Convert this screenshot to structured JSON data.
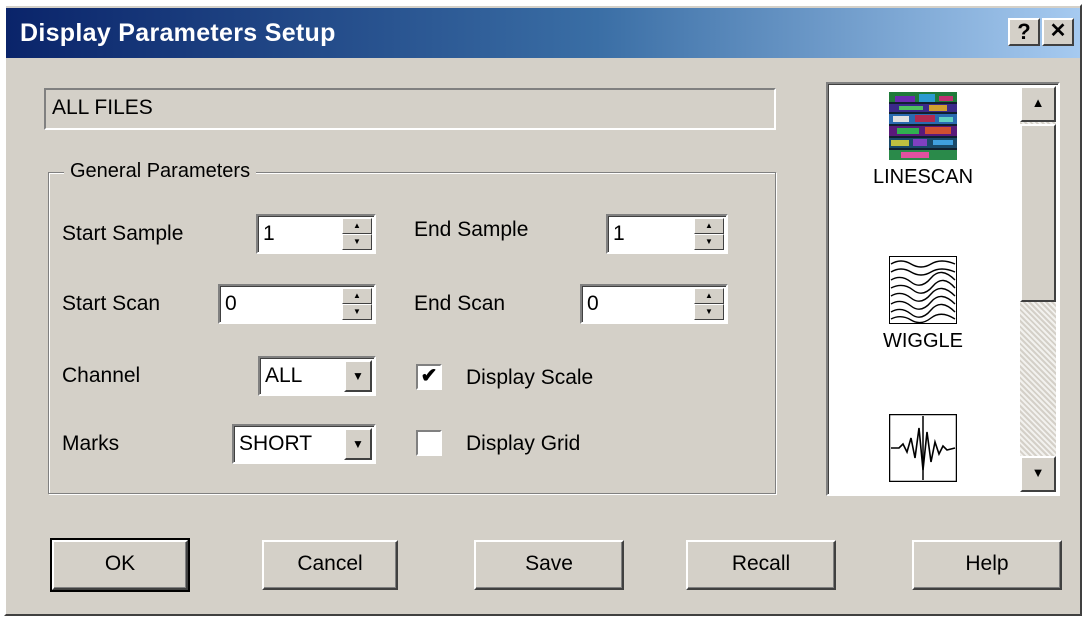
{
  "window": {
    "title": "Display Parameters Setup",
    "help_glyph": "?",
    "close_glyph": "✕"
  },
  "path_field": {
    "value": "ALL FILES"
  },
  "general": {
    "legend": "General Parameters",
    "start_sample": {
      "label": "Start Sample",
      "value": "1"
    },
    "end_sample": {
      "label": "End Sample",
      "value": "1"
    },
    "start_scan": {
      "label": "Start Scan",
      "value": "0"
    },
    "end_scan": {
      "label": "End Scan",
      "value": "0"
    },
    "channel": {
      "label": "Channel",
      "value": "ALL"
    },
    "marks": {
      "label": "Marks",
      "value": "SHORT"
    },
    "display_scale": {
      "label": "Display Scale",
      "checked": true,
      "mark": "✔"
    },
    "display_grid": {
      "label": "Display Grid",
      "checked": false,
      "mark": ""
    }
  },
  "display_types": [
    {
      "label": "LINESCAN",
      "icon": "linescan-icon"
    },
    {
      "label": "WIGGLE",
      "icon": "wiggle-icon"
    },
    {
      "label": "",
      "icon": "waveform-icon"
    }
  ],
  "buttons": {
    "ok": "OK",
    "cancel": "Cancel",
    "save": "Save",
    "recall": "Recall",
    "help": "Help"
  },
  "colors": {
    "title_start": "#0a246a",
    "title_end": "#a6caf0",
    "face": "#d4d0c8"
  }
}
